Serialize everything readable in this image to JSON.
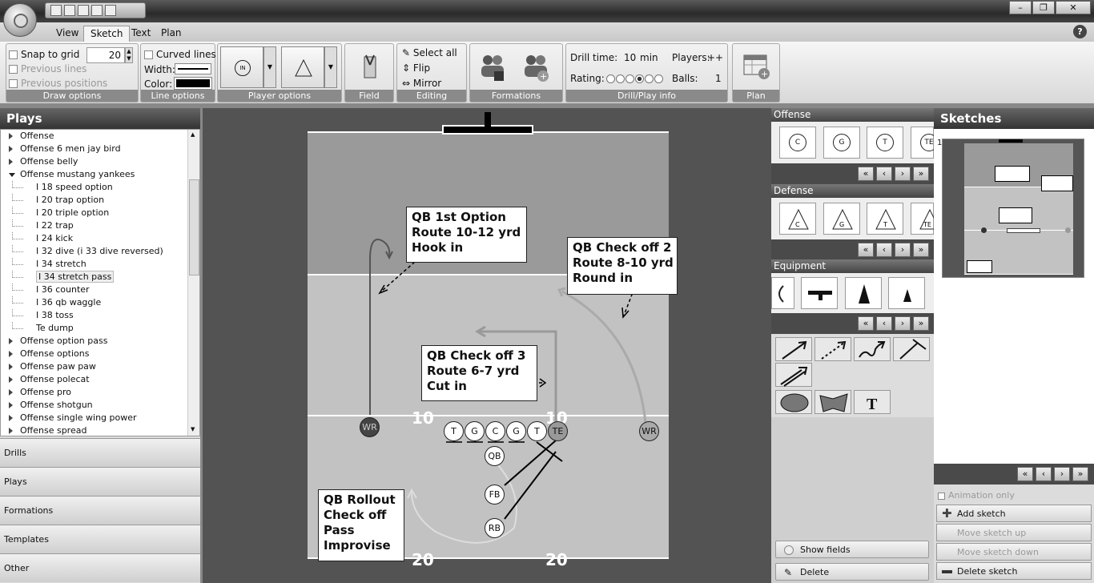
{
  "window": {
    "minimize": "–",
    "maximize": "❐",
    "close": "✕"
  },
  "ribbon_tabs": [
    "View",
    "Sketch",
    "Text",
    "Plan"
  ],
  "help": "?",
  "draw_options": {
    "caption": "Draw options",
    "snap_to_grid": "Snap to grid",
    "grid_value": "20",
    "previous_lines": "Previous lines",
    "previous_positions": "Previous positions"
  },
  "line_options": {
    "caption": "Line options",
    "curved_lines": "Curved lines",
    "width": "Width:",
    "color": "Color:"
  },
  "player_options": {
    "caption": "Player options",
    "btn1": "IN",
    "btn2": "IN"
  },
  "field_group": {
    "caption": "Field"
  },
  "editing": {
    "caption": "Editing",
    "select_all": "Select all",
    "flip": "Flip",
    "mirror": "Mirror"
  },
  "formations": {
    "caption": "Formations"
  },
  "drill_info": {
    "caption": "Drill/Play info",
    "drill_time_label": "Drill time:",
    "drill_time_value": "10",
    "drill_time_unit": "min",
    "players_label": "Players:",
    "players_value": "++",
    "rating_label": "Rating:",
    "rating_value": 3,
    "balls_label": "Balls:",
    "balls_value": "1"
  },
  "plan_group": {
    "caption": "Plan"
  },
  "left_panel": {
    "title": "Plays",
    "tree": [
      {
        "label": "Offense",
        "level": 0,
        "expanded": false
      },
      {
        "label": "Offense 6 men jay bird",
        "level": 0,
        "expanded": false
      },
      {
        "label": "Offense belly",
        "level": 0,
        "expanded": false
      },
      {
        "label": "Offense mustang yankees",
        "level": 0,
        "expanded": true
      },
      {
        "label": "I 18 speed option",
        "level": 1
      },
      {
        "label": "I 20 trap option",
        "level": 1
      },
      {
        "label": "I 20 triple option",
        "level": 1
      },
      {
        "label": "I 22 trap",
        "level": 1
      },
      {
        "label": "I 24 kick",
        "level": 1
      },
      {
        "label": "I 32 dive (i 33 dive reversed)",
        "level": 1
      },
      {
        "label": "I 34 stretch",
        "level": 1
      },
      {
        "label": "I 34 stretch pass",
        "level": 1,
        "selected": true
      },
      {
        "label": "I 36 counter",
        "level": 1
      },
      {
        "label": "I 36 qb waggle",
        "level": 1
      },
      {
        "label": "I 38 toss",
        "level": 1
      },
      {
        "label": "Te dump",
        "level": 1
      },
      {
        "label": "Offense option pass",
        "level": 0,
        "expanded": false
      },
      {
        "label": "Offense options",
        "level": 0,
        "expanded": false
      },
      {
        "label": "Offense paw paw",
        "level": 0,
        "expanded": false
      },
      {
        "label": "Offense polecat",
        "level": 0,
        "expanded": false
      },
      {
        "label": "Offense pro",
        "level": 0,
        "expanded": false
      },
      {
        "label": "Offense shotgun",
        "level": 0,
        "expanded": false
      },
      {
        "label": "Offense single wing power",
        "level": 0,
        "expanded": false
      },
      {
        "label": "Offense spread",
        "level": 0,
        "expanded": false
      }
    ],
    "sections": [
      "Drills",
      "Plays",
      "Formations",
      "Templates",
      "Other"
    ]
  },
  "field": {
    "textboxes": [
      {
        "id": "tb1",
        "text": "QB 1st Option\nRoute 10-12 yrd\nHook in"
      },
      {
        "id": "tb2",
        "text": "QB Check off 2\nRoute 8-10 yrd\nRound in"
      },
      {
        "id": "tb3",
        "text": "QB Check off 3\nRoute 6-7 yrd\nCut in"
      },
      {
        "id": "tb4",
        "text": "QB Rollout\nCheck off\nPass\nImprovise"
      }
    ],
    "yard_labels": [
      "10",
      "10",
      "20",
      "20"
    ],
    "players": [
      "WR",
      "T",
      "G",
      "C",
      "G",
      "T",
      "TE",
      "WR",
      "QB",
      "FB",
      "RB"
    ]
  },
  "palette": {
    "offense": {
      "title": "Offense",
      "items": [
        "C",
        "G",
        "T",
        "TE"
      ]
    },
    "defense": {
      "title": "Defense",
      "items": [
        "C",
        "G",
        "T",
        "TE"
      ]
    },
    "equipment": {
      "title": "Equipment"
    },
    "nav": [
      "«",
      "‹",
      "›",
      "»"
    ],
    "show_fields": "Show fields",
    "delete": "Delete"
  },
  "sketches": {
    "title": "Sketches",
    "thumb_number": "1",
    "animation_only": "Animation only",
    "add": "Add sketch",
    "move_up": "Move sketch up",
    "move_down": "Move sketch down",
    "delete": "Delete sketch"
  }
}
